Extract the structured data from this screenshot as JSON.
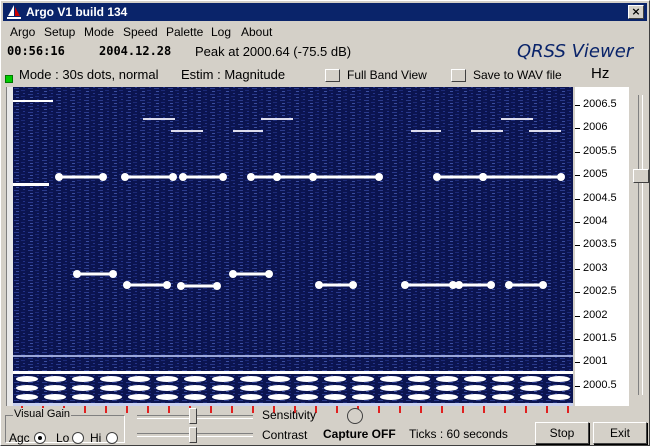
{
  "window": {
    "title": "Argo V1 build 134",
    "close_glyph": "×"
  },
  "menu": [
    "Argo",
    "Setup",
    "Mode",
    "Speed",
    "Palette",
    "Log",
    "About"
  ],
  "info": {
    "time": "00:56:16",
    "date": "2004.12.28",
    "peak": "Peak at 2000.64 (-75.5 dB)",
    "brand": "QRSS Viewer"
  },
  "status": {
    "mode": "Mode : 30s dots, normal",
    "estim": "Estim : Magnitude",
    "full_band_label": "Full Band View",
    "save_wav_label": "Save to WAV file",
    "unit": "Hz"
  },
  "axis": {
    "ticks": [
      "2006.5",
      "2006",
      "2005.5",
      "2005",
      "2004.5",
      "2004",
      "2003.5",
      "2003",
      "2002.5",
      "2002",
      "2001.5",
      "2001",
      "2000.5"
    ]
  },
  "controls": {
    "visual_gain_title": "Visual Gain",
    "agc_label": "Agc",
    "lo_label": "Lo",
    "hi_label": "Hi",
    "gain_selected": "Agc",
    "sensitivity_label": "Sensitivity",
    "contrast_label": "Contrast",
    "capture_label": "Capture OFF",
    "ticks_label": "Ticks : 60 seconds",
    "stop_label": "Stop",
    "exit_label": "Exit"
  },
  "colors": {
    "titlebar": "#0a246a",
    "face": "#d4d0c8",
    "waterfall_bg": "#0b1450",
    "signal": "#ffffff",
    "tick_marks": "#e02020"
  }
}
